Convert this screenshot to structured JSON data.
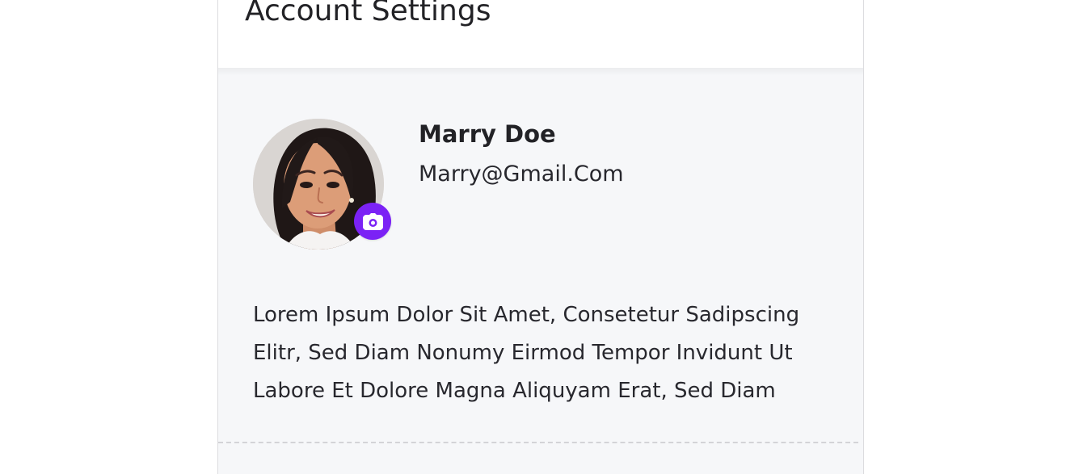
{
  "page": {
    "title": "Account Settings"
  },
  "profile": {
    "name": "Marry Doe",
    "email": "Marry@Gmail.Com",
    "bio": "Lorem Ipsum Dolor Sit Amet, Consetetur Sadipscing\nElitr, Sed Diam Nonumy Eirmod Tempor Invidunt Ut\nLabore Et Dolore Magna Aliquyam Erat, Sed Diam",
    "avatar_icon": "user-photo",
    "camera_icon": "camera-icon"
  },
  "colors": {
    "accent": "#7b22f5",
    "content_background": "#f6f7f9",
    "text": "#222226",
    "divider": "#d3d3d7"
  }
}
